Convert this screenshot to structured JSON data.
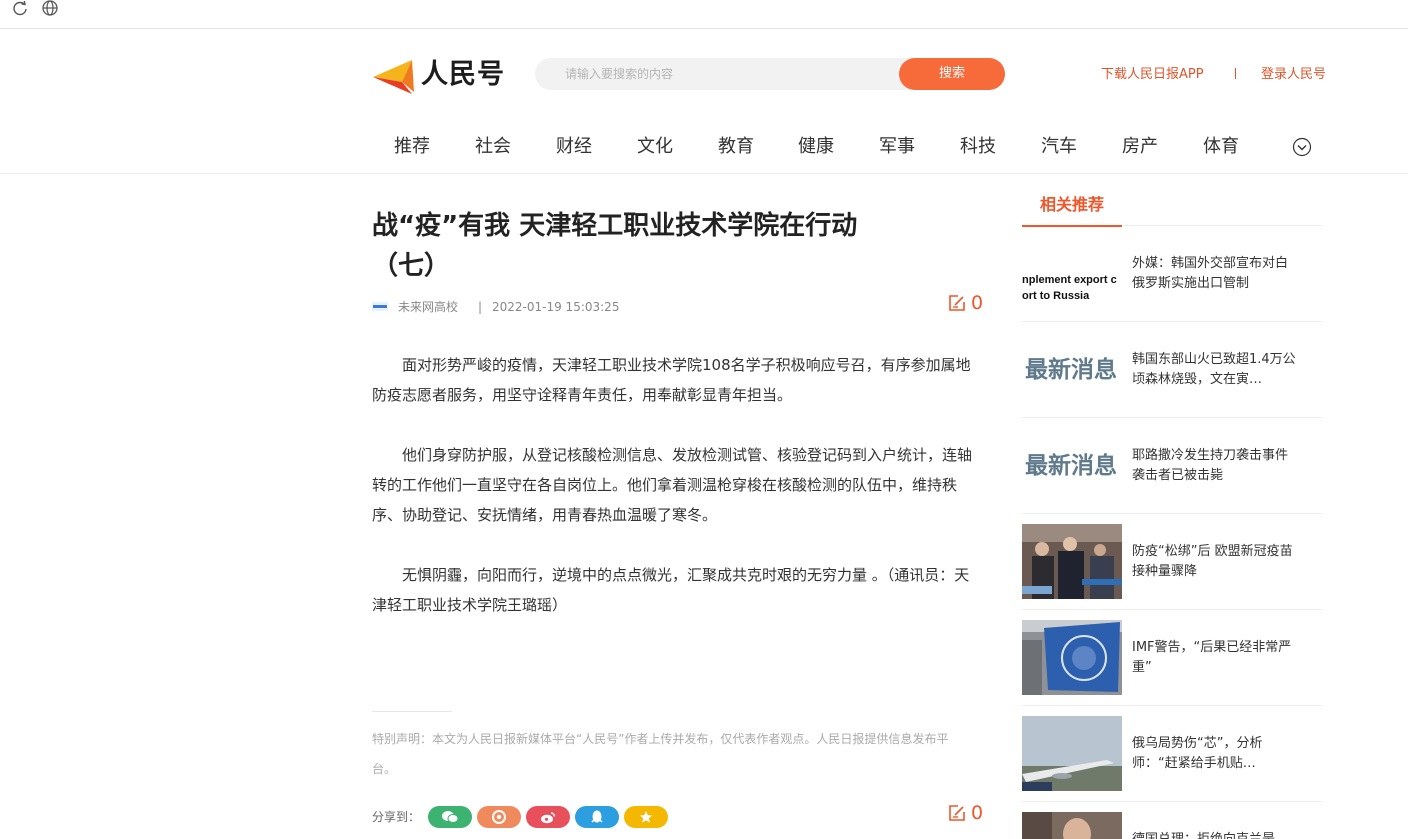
{
  "browser": {
    "reload_icon": "reload-icon",
    "globe_icon": "globe-icon"
  },
  "header": {
    "logo_text": "人民号",
    "search": {
      "placeholder": "请输入要搜索的内容",
      "button_label": "搜索"
    },
    "download_link": "下载人民日报APP",
    "login_link": "登录人民号",
    "accent_color": "#f76a3a"
  },
  "nav": {
    "items": [
      "推荐",
      "社会",
      "财经",
      "文化",
      "教育",
      "健康",
      "军事",
      "科技",
      "汽车",
      "房产",
      "体育"
    ]
  },
  "article": {
    "title_line1": "战“疫”有我 天津轻工职业技术学院在行动",
    "title_line2": "（七）",
    "source": "未来网高校",
    "date": "2022-01-19 15:03:25",
    "comments": "0",
    "paragraphs": [
      "面对形势严峻的疫情，天津轻工职业技术学院108名学子积极响应号召，有序参加属地防疫志愿者服务，用坚守诠释青年责任，用奉献彰显青年担当。",
      "他们身穿防护服，从登记核酸检测信息、发放检测试管、核验登记码到入户统计，连轴转的工作他们一直坚守在各自岗位上。他们拿着测温枪穿梭在核酸检测的队伍中，维持秩序、协助登记、安抚情绪，用青春热血温暖了寒冬。",
      "无惧阴霾，向阳而行，逆境中的点点微光，汇聚成共克时艰的无穷力量 。（通讯员：天津轻工职业技术学院王璐瑶）"
    ],
    "notice": "特别声明：本文为人民日报新媒体平台“人民号”作者上传并发布，仅代表作者观点。人民日报提供信息发布平台。",
    "share_label": "分享到：",
    "share_buttons": [
      {
        "icon": "wechat-icon",
        "color": "#3cb371"
      },
      {
        "icon": "moments-icon",
        "color": "#f08a5d"
      },
      {
        "icon": "weibo-icon",
        "color": "#e8505b"
      },
      {
        "icon": "qq-icon",
        "color": "#2d9ee0"
      },
      {
        "icon": "qzone-star-icon",
        "color": "#f5b800"
      }
    ],
    "bottom_comments": "0"
  },
  "sidebar": {
    "tab_label": "相关推荐",
    "items": [
      {
        "title": "外媒：韩国外交部宣布对白俄罗斯实施出口管制",
        "thumb_text_1": "nplement export c",
        "thumb_text_2": "ort to Russia"
      },
      {
        "title": "韩国东部山火已致超1.4万公顷森林烧毁，文在寅…",
        "thumb_text_1": "最新消息"
      },
      {
        "title": "耶路撒冷发生持刀袭击事件 袭击者已被击毙",
        "thumb_text_1": "最新消息"
      },
      {
        "title": "防疫“松绑”后 欧盟新冠疫苗接种量骤降"
      },
      {
        "title": "IMF警告，“后果已经非常严重”"
      },
      {
        "title": "俄乌局势伤“芯”，分析师：“赶紧给手机贴…"
      },
      {
        "title": "德国总理：拒绝向克兰是"
      }
    ]
  }
}
